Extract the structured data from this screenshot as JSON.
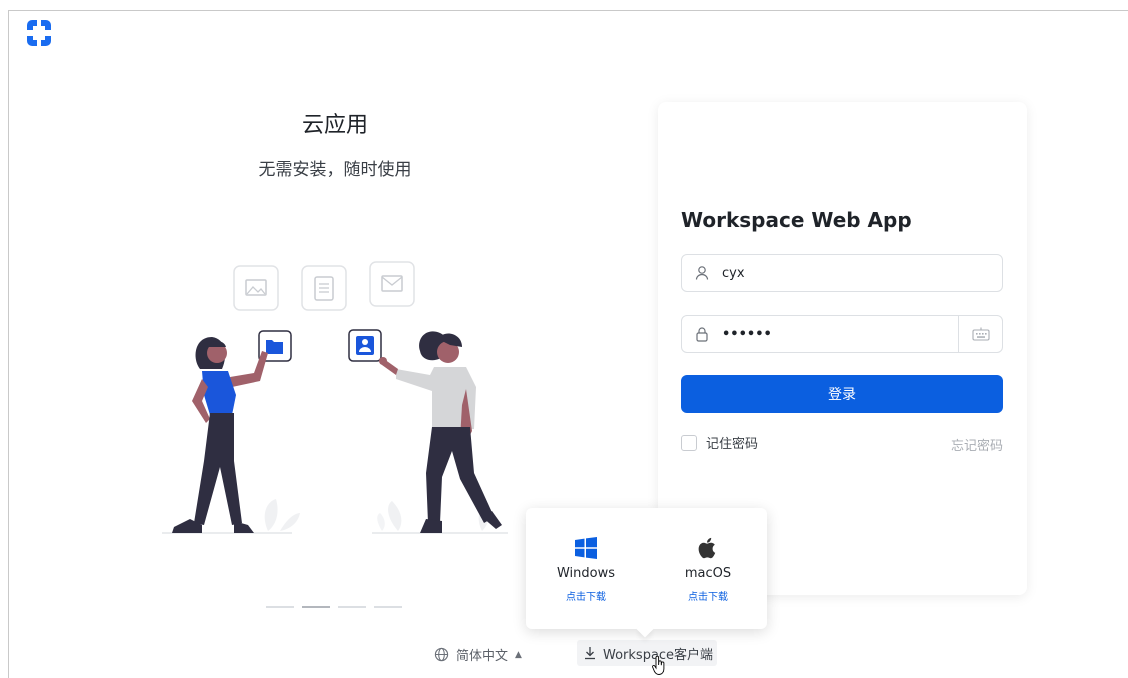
{
  "hero": {
    "title": "云应用",
    "subtitle": "无需安装，随时使用"
  },
  "carousel": {
    "count": 4,
    "active_index": 1
  },
  "login": {
    "title": "Workspace Web App",
    "username_value": "cyx",
    "password_mask": "••••••",
    "login_button": "登录",
    "remember_label": "记住密码",
    "remember_checked": false,
    "forgot_link": "忘记密码"
  },
  "footer": {
    "language_label": "简体中文",
    "download_label": "Workspace客户端"
  },
  "download_popover": {
    "windows": {
      "name": "Windows",
      "link": "点击下载"
    },
    "macos": {
      "name": "macOS",
      "link": "点击下载"
    }
  },
  "colors": {
    "accent": "#0b5fe0",
    "figure_shirt": "#1a56db",
    "figure_dark": "#2f2e41",
    "skin": "#a0616a"
  },
  "icons": {
    "logo": "app-logo-icon",
    "user": "user-icon",
    "lock": "lock-icon",
    "keyboard": "keyboard-icon",
    "globe": "globe-icon",
    "download": "download-icon",
    "windows": "windows-icon",
    "apple": "apple-icon",
    "cursor": "hand-cursor-icon"
  }
}
